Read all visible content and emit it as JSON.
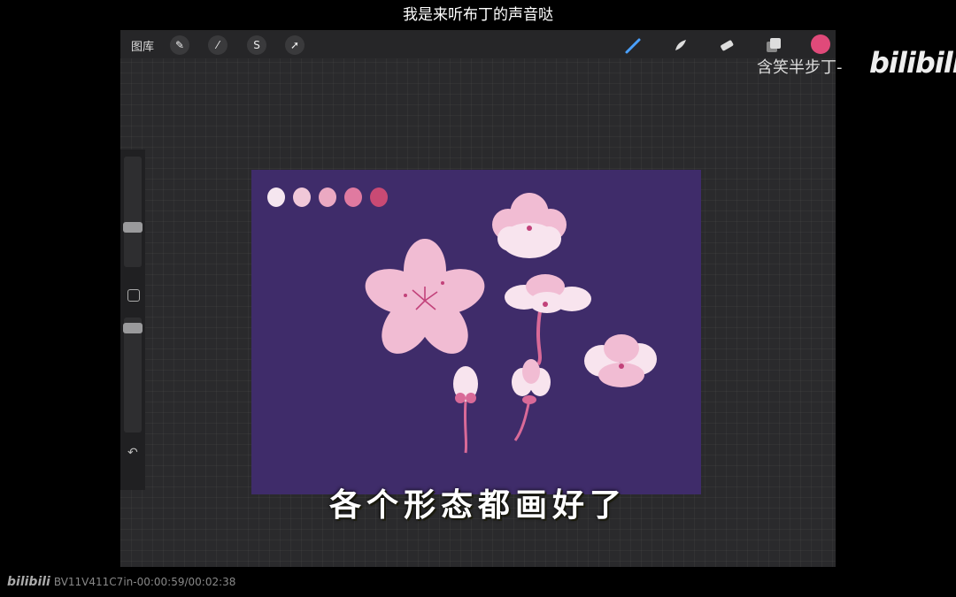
{
  "caption_top": "我是来听布丁的声音哒",
  "toolbar": {
    "gallery_label": "图库",
    "left_tools": [
      "wrench-icon",
      "magic-wand-icon",
      "selection-icon",
      "transform-arrow-icon"
    ],
    "right_tools": [
      "brush-icon",
      "smudge-icon",
      "eraser-icon",
      "layers-icon"
    ],
    "current_color": "#e04a7a"
  },
  "watermark": {
    "uploader": "含笑半步丁-",
    "logo": "bilibili"
  },
  "canvas": {
    "background": "#3f2c6a",
    "palette": [
      "#f5e6ef",
      "#f0c8d8",
      "#eba9c2",
      "#e07aa0",
      "#c94a74"
    ]
  },
  "subtitle": "各个形态都画好了",
  "footer": {
    "logo": "bilibili",
    "video_id": "BV11V411C7in-00:00:59/00:02:38"
  }
}
